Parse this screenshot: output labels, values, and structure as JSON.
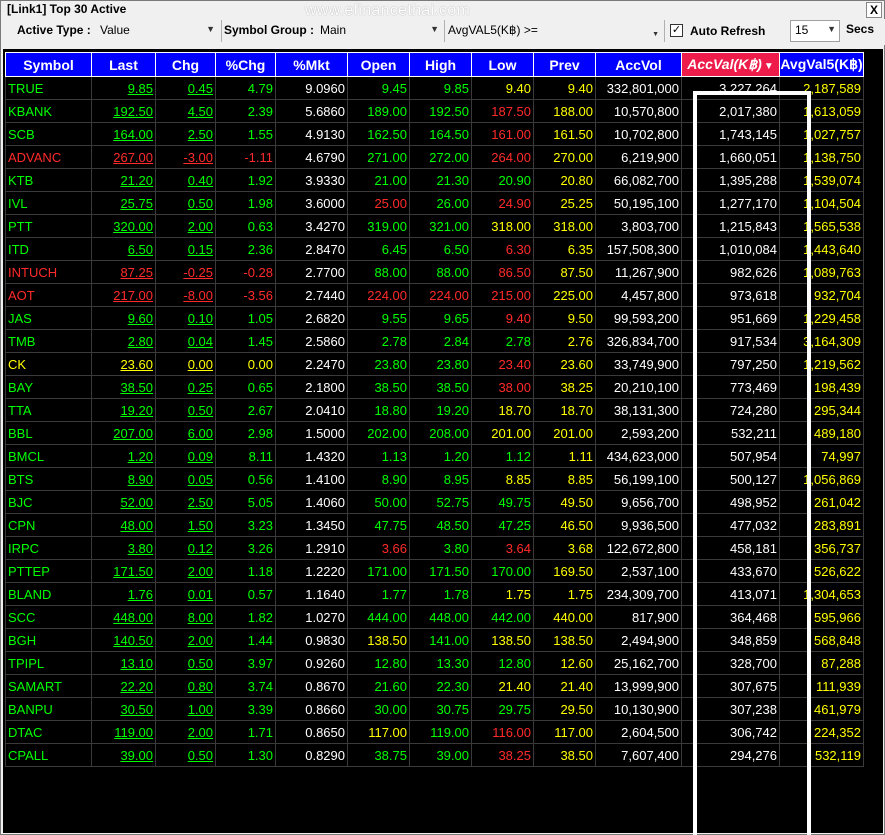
{
  "window": {
    "title": "[Link1] Top 30 Active",
    "watermark": "www.efinancethai.com",
    "close_label": "X"
  },
  "toolbar": {
    "active_type_label": "Active Type :",
    "active_type_value": "Value",
    "symbol_group_label": "Symbol Group :",
    "symbol_group_value": "Main",
    "avgval_label": "AvgVAL5(K฿) >=",
    "avgval_value": "",
    "auto_refresh_checked": "✓",
    "auto_refresh_label": "Auto Refresh",
    "refresh_interval": "15",
    "secs_label": "Secs"
  },
  "columns": [
    "Symbol",
    "Last",
    "Chg",
    "%Chg",
    "%Mkt",
    "Open",
    "High",
    "Low",
    "Prev",
    "AccVol",
    "AccVal(K฿)",
    "AvgVal5(K฿)"
  ],
  "rows": [
    {
      "symbol": "TRUE",
      "last": "9.85",
      "chg": "0.45",
      "pchg": "4.79",
      "pmkt": "9.0960",
      "open": "9.45",
      "high": "9.85",
      "low": "9.40",
      "prev": "9.40",
      "accvol": "332,801,000",
      "accval": "3,227,264",
      "avgval5": "2,187,589",
      "c": [
        "green",
        "green",
        "green",
        "green",
        "white",
        "green",
        "green",
        "yellow",
        "yellow",
        "white",
        "white",
        "yellow"
      ]
    },
    {
      "symbol": "KBANK",
      "last": "192.50",
      "chg": "4.50",
      "pchg": "2.39",
      "pmkt": "5.6860",
      "open": "189.00",
      "high": "192.50",
      "low": "187.50",
      "prev": "188.00",
      "accvol": "10,570,800",
      "accval": "2,017,380",
      "avgval5": "1,613,059",
      "c": [
        "green",
        "green",
        "green",
        "green",
        "white",
        "green",
        "green",
        "red",
        "yellow",
        "white",
        "white",
        "yellow"
      ]
    },
    {
      "symbol": "SCB",
      "last": "164.00",
      "chg": "2.50",
      "pchg": "1.55",
      "pmkt": "4.9130",
      "open": "162.50",
      "high": "164.50",
      "low": "161.00",
      "prev": "161.50",
      "accvol": "10,702,800",
      "accval": "1,743,145",
      "avgval5": "1,027,757",
      "c": [
        "green",
        "green",
        "green",
        "green",
        "white",
        "green",
        "green",
        "red",
        "yellow",
        "white",
        "white",
        "yellow"
      ]
    },
    {
      "symbol": "ADVANC",
      "last": "267.00",
      "chg": "-3.00",
      "pchg": "-1.11",
      "pmkt": "4.6790",
      "open": "271.00",
      "high": "272.00",
      "low": "264.00",
      "prev": "270.00",
      "accvol": "6,219,900",
      "accval": "1,660,051",
      "avgval5": "1,138,750",
      "c": [
        "red",
        "red",
        "red",
        "red",
        "white",
        "green",
        "green",
        "red",
        "yellow",
        "white",
        "white",
        "yellow"
      ]
    },
    {
      "symbol": "KTB",
      "last": "21.20",
      "chg": "0.40",
      "pchg": "1.92",
      "pmkt": "3.9330",
      "open": "21.00",
      "high": "21.30",
      "low": "20.90",
      "prev": "20.80",
      "accvol": "66,082,700",
      "accval": "1,395,288",
      "avgval5": "1,539,074",
      "c": [
        "green",
        "green",
        "green",
        "green",
        "white",
        "green",
        "green",
        "green",
        "yellow",
        "white",
        "white",
        "yellow"
      ]
    },
    {
      "symbol": "IVL",
      "last": "25.75",
      "chg": "0.50",
      "pchg": "1.98",
      "pmkt": "3.6000",
      "open": "25.00",
      "high": "26.00",
      "low": "24.90",
      "prev": "25.25",
      "accvol": "50,195,100",
      "accval": "1,277,170",
      "avgval5": "1,104,504",
      "c": [
        "green",
        "green",
        "green",
        "green",
        "white",
        "red",
        "green",
        "red",
        "yellow",
        "white",
        "white",
        "yellow"
      ]
    },
    {
      "symbol": "PTT",
      "last": "320.00",
      "chg": "2.00",
      "pchg": "0.63",
      "pmkt": "3.4270",
      "open": "319.00",
      "high": "321.00",
      "low": "318.00",
      "prev": "318.00",
      "accvol": "3,803,700",
      "accval": "1,215,843",
      "avgval5": "1,565,538",
      "c": [
        "green",
        "green",
        "green",
        "green",
        "white",
        "green",
        "green",
        "yellow",
        "yellow",
        "white",
        "white",
        "yellow"
      ]
    },
    {
      "symbol": "ITD",
      "last": "6.50",
      "chg": "0.15",
      "pchg": "2.36",
      "pmkt": "2.8470",
      "open": "6.45",
      "high": "6.50",
      "low": "6.30",
      "prev": "6.35",
      "accvol": "157,508,300",
      "accval": "1,010,084",
      "avgval5": "1,443,640",
      "c": [
        "green",
        "green",
        "green",
        "green",
        "white",
        "green",
        "green",
        "red",
        "yellow",
        "white",
        "white",
        "yellow"
      ]
    },
    {
      "symbol": "INTUCH",
      "last": "87.25",
      "chg": "-0.25",
      "pchg": "-0.28",
      "pmkt": "2.7700",
      "open": "88.00",
      "high": "88.00",
      "low": "86.50",
      "prev": "87.50",
      "accvol": "11,267,900",
      "accval": "982,626",
      "avgval5": "1,089,763",
      "c": [
        "red",
        "red",
        "red",
        "red",
        "white",
        "green",
        "green",
        "red",
        "yellow",
        "white",
        "white",
        "yellow"
      ]
    },
    {
      "symbol": "AOT",
      "last": "217.00",
      "chg": "-8.00",
      "pchg": "-3.56",
      "pmkt": "2.7440",
      "open": "224.00",
      "high": "224.00",
      "low": "215.00",
      "prev": "225.00",
      "accvol": "4,457,800",
      "accval": "973,618",
      "avgval5": "932,704",
      "c": [
        "red",
        "red",
        "red",
        "red",
        "white",
        "red",
        "red",
        "red",
        "yellow",
        "white",
        "white",
        "yellow"
      ]
    },
    {
      "symbol": "JAS",
      "last": "9.60",
      "chg": "0.10",
      "pchg": "1.05",
      "pmkt": "2.6820",
      "open": "9.55",
      "high": "9.65",
      "low": "9.40",
      "prev": "9.50",
      "accvol": "99,593,200",
      "accval": "951,669",
      "avgval5": "1,229,458",
      "c": [
        "green",
        "green",
        "green",
        "green",
        "white",
        "green",
        "green",
        "red",
        "yellow",
        "white",
        "white",
        "yellow"
      ]
    },
    {
      "symbol": "TMB",
      "last": "2.80",
      "chg": "0.04",
      "pchg": "1.45",
      "pmkt": "2.5860",
      "open": "2.78",
      "high": "2.84",
      "low": "2.78",
      "prev": "2.76",
      "accvol": "326,834,700",
      "accval": "917,534",
      "avgval5": "3,164,309",
      "c": [
        "green",
        "green",
        "green",
        "green",
        "white",
        "green",
        "green",
        "green",
        "yellow",
        "white",
        "white",
        "yellow"
      ]
    },
    {
      "symbol": "CK",
      "last": "23.60",
      "chg": "0.00",
      "pchg": "0.00",
      "pmkt": "2.2470",
      "open": "23.80",
      "high": "23.80",
      "low": "23.40",
      "prev": "23.60",
      "accvol": "33,749,900",
      "accval": "797,250",
      "avgval5": "1,219,562",
      "c": [
        "yellow",
        "yellow",
        "yellow",
        "yellow",
        "white",
        "green",
        "green",
        "red",
        "yellow",
        "white",
        "white",
        "yellow"
      ]
    },
    {
      "symbol": "BAY",
      "last": "38.50",
      "chg": "0.25",
      "pchg": "0.65",
      "pmkt": "2.1800",
      "open": "38.50",
      "high": "38.50",
      "low": "38.00",
      "prev": "38.25",
      "accvol": "20,210,100",
      "accval": "773,469",
      "avgval5": "198,439",
      "c": [
        "green",
        "green",
        "green",
        "green",
        "white",
        "green",
        "green",
        "red",
        "yellow",
        "white",
        "white",
        "yellow"
      ]
    },
    {
      "symbol": "TTA",
      "last": "19.20",
      "chg": "0.50",
      "pchg": "2.67",
      "pmkt": "2.0410",
      "open": "18.80",
      "high": "19.20",
      "low": "18.70",
      "prev": "18.70",
      "accvol": "38,131,300",
      "accval": "724,280",
      "avgval5": "295,344",
      "c": [
        "green",
        "green",
        "green",
        "green",
        "white",
        "green",
        "green",
        "yellow",
        "yellow",
        "white",
        "white",
        "yellow"
      ]
    },
    {
      "symbol": "BBL",
      "last": "207.00",
      "chg": "6.00",
      "pchg": "2.98",
      "pmkt": "1.5000",
      "open": "202.00",
      "high": "208.00",
      "low": "201.00",
      "prev": "201.00",
      "accvol": "2,593,200",
      "accval": "532,211",
      "avgval5": "489,180",
      "c": [
        "green",
        "green",
        "green",
        "green",
        "white",
        "green",
        "green",
        "yellow",
        "yellow",
        "white",
        "white",
        "yellow"
      ]
    },
    {
      "symbol": "BMCL",
      "last": "1.20",
      "chg": "0.09",
      "pchg": "8.11",
      "pmkt": "1.4320",
      "open": "1.13",
      "high": "1.20",
      "low": "1.12",
      "prev": "1.11",
      "accvol": "434,623,000",
      "accval": "507,954",
      "avgval5": "74,997",
      "c": [
        "green",
        "green",
        "green",
        "green",
        "white",
        "green",
        "green",
        "green",
        "yellow",
        "white",
        "white",
        "yellow"
      ]
    },
    {
      "symbol": "BTS",
      "last": "8.90",
      "chg": "0.05",
      "pchg": "0.56",
      "pmkt": "1.4100",
      "open": "8.90",
      "high": "8.95",
      "low": "8.85",
      "prev": "8.85",
      "accvol": "56,199,100",
      "accval": "500,127",
      "avgval5": "1,056,869",
      "c": [
        "green",
        "green",
        "green",
        "green",
        "white",
        "green",
        "green",
        "yellow",
        "yellow",
        "white",
        "white",
        "yellow"
      ]
    },
    {
      "symbol": "BJC",
      "last": "52.00",
      "chg": "2.50",
      "pchg": "5.05",
      "pmkt": "1.4060",
      "open": "50.00",
      "high": "52.75",
      "low": "49.75",
      "prev": "49.50",
      "accvol": "9,656,700",
      "accval": "498,952",
      "avgval5": "261,042",
      "c": [
        "green",
        "green",
        "green",
        "green",
        "white",
        "green",
        "green",
        "green",
        "yellow",
        "white",
        "white",
        "yellow"
      ]
    },
    {
      "symbol": "CPN",
      "last": "48.00",
      "chg": "1.50",
      "pchg": "3.23",
      "pmkt": "1.3450",
      "open": "47.75",
      "high": "48.50",
      "low": "47.25",
      "prev": "46.50",
      "accvol": "9,936,500",
      "accval": "477,032",
      "avgval5": "283,891",
      "c": [
        "green",
        "green",
        "green",
        "green",
        "white",
        "green",
        "green",
        "green",
        "yellow",
        "white",
        "white",
        "yellow"
      ]
    },
    {
      "symbol": "IRPC",
      "last": "3.80",
      "chg": "0.12",
      "pchg": "3.26",
      "pmkt": "1.2910",
      "open": "3.66",
      "high": "3.80",
      "low": "3.64",
      "prev": "3.68",
      "accvol": "122,672,800",
      "accval": "458,181",
      "avgval5": "356,737",
      "c": [
        "green",
        "green",
        "green",
        "green",
        "white",
        "red",
        "green",
        "red",
        "yellow",
        "white",
        "white",
        "yellow"
      ]
    },
    {
      "symbol": "PTTEP",
      "last": "171.50",
      "chg": "2.00",
      "pchg": "1.18",
      "pmkt": "1.2220",
      "open": "171.00",
      "high": "171.50",
      "low": "170.00",
      "prev": "169.50",
      "accvol": "2,537,100",
      "accval": "433,670",
      "avgval5": "526,622",
      "c": [
        "green",
        "green",
        "green",
        "green",
        "white",
        "green",
        "green",
        "green",
        "yellow",
        "white",
        "white",
        "yellow"
      ]
    },
    {
      "symbol": "BLAND",
      "last": "1.76",
      "chg": "0.01",
      "pchg": "0.57",
      "pmkt": "1.1640",
      "open": "1.77",
      "high": "1.78",
      "low": "1.75",
      "prev": "1.75",
      "accvol": "234,309,700",
      "accval": "413,071",
      "avgval5": "1,304,653",
      "c": [
        "green",
        "green",
        "green",
        "green",
        "white",
        "green",
        "green",
        "yellow",
        "yellow",
        "white",
        "white",
        "yellow"
      ]
    },
    {
      "symbol": "SCC",
      "last": "448.00",
      "chg": "8.00",
      "pchg": "1.82",
      "pmkt": "1.0270",
      "open": "444.00",
      "high": "448.00",
      "low": "442.00",
      "prev": "440.00",
      "accvol": "817,900",
      "accval": "364,468",
      "avgval5": "595,966",
      "c": [
        "green",
        "green",
        "green",
        "green",
        "white",
        "green",
        "green",
        "green",
        "yellow",
        "white",
        "white",
        "yellow"
      ]
    },
    {
      "symbol": "BGH",
      "last": "140.50",
      "chg": "2.00",
      "pchg": "1.44",
      "pmkt": "0.9830",
      "open": "138.50",
      "high": "141.00",
      "low": "138.50",
      "prev": "138.50",
      "accvol": "2,494,900",
      "accval": "348,859",
      "avgval5": "568,848",
      "c": [
        "green",
        "green",
        "green",
        "green",
        "white",
        "yellow",
        "green",
        "yellow",
        "yellow",
        "white",
        "white",
        "yellow"
      ]
    },
    {
      "symbol": "TPIPL",
      "last": "13.10",
      "chg": "0.50",
      "pchg": "3.97",
      "pmkt": "0.9260",
      "open": "12.80",
      "high": "13.30",
      "low": "12.80",
      "prev": "12.60",
      "accvol": "25,162,700",
      "accval": "328,700",
      "avgval5": "87,288",
      "c": [
        "green",
        "green",
        "green",
        "green",
        "white",
        "green",
        "green",
        "green",
        "yellow",
        "white",
        "white",
        "yellow"
      ]
    },
    {
      "symbol": "SAMART",
      "last": "22.20",
      "chg": "0.80",
      "pchg": "3.74",
      "pmkt": "0.8670",
      "open": "21.60",
      "high": "22.30",
      "low": "21.40",
      "prev": "21.40",
      "accvol": "13,999,900",
      "accval": "307,675",
      "avgval5": "111,939",
      "c": [
        "green",
        "green",
        "green",
        "green",
        "white",
        "green",
        "green",
        "yellow",
        "yellow",
        "white",
        "white",
        "yellow"
      ]
    },
    {
      "symbol": "BANPU",
      "last": "30.50",
      "chg": "1.00",
      "pchg": "3.39",
      "pmkt": "0.8660",
      "open": "30.00",
      "high": "30.75",
      "low": "29.75",
      "prev": "29.50",
      "accvol": "10,130,900",
      "accval": "307,238",
      "avgval5": "461,979",
      "c": [
        "green",
        "green",
        "green",
        "green",
        "white",
        "green",
        "green",
        "green",
        "yellow",
        "white",
        "white",
        "yellow"
      ]
    },
    {
      "symbol": "DTAC",
      "last": "119.00",
      "chg": "2.00",
      "pchg": "1.71",
      "pmkt": "0.8650",
      "open": "117.00",
      "high": "119.00",
      "low": "116.00",
      "prev": "117.00",
      "accvol": "2,604,500",
      "accval": "306,742",
      "avgval5": "224,352",
      "c": [
        "green",
        "green",
        "green",
        "green",
        "white",
        "yellow",
        "green",
        "red",
        "yellow",
        "white",
        "white",
        "yellow"
      ]
    },
    {
      "symbol": "CPALL",
      "last": "39.00",
      "chg": "0.50",
      "pchg": "1.30",
      "pmkt": "0.8290",
      "open": "38.75",
      "high": "39.00",
      "low": "38.25",
      "prev": "38.50",
      "accvol": "7,607,400",
      "accval": "294,276",
      "avgval5": "532,119",
      "c": [
        "green",
        "green",
        "green",
        "green",
        "white",
        "green",
        "green",
        "red",
        "yellow",
        "white",
        "white",
        "yellow"
      ]
    }
  ]
}
